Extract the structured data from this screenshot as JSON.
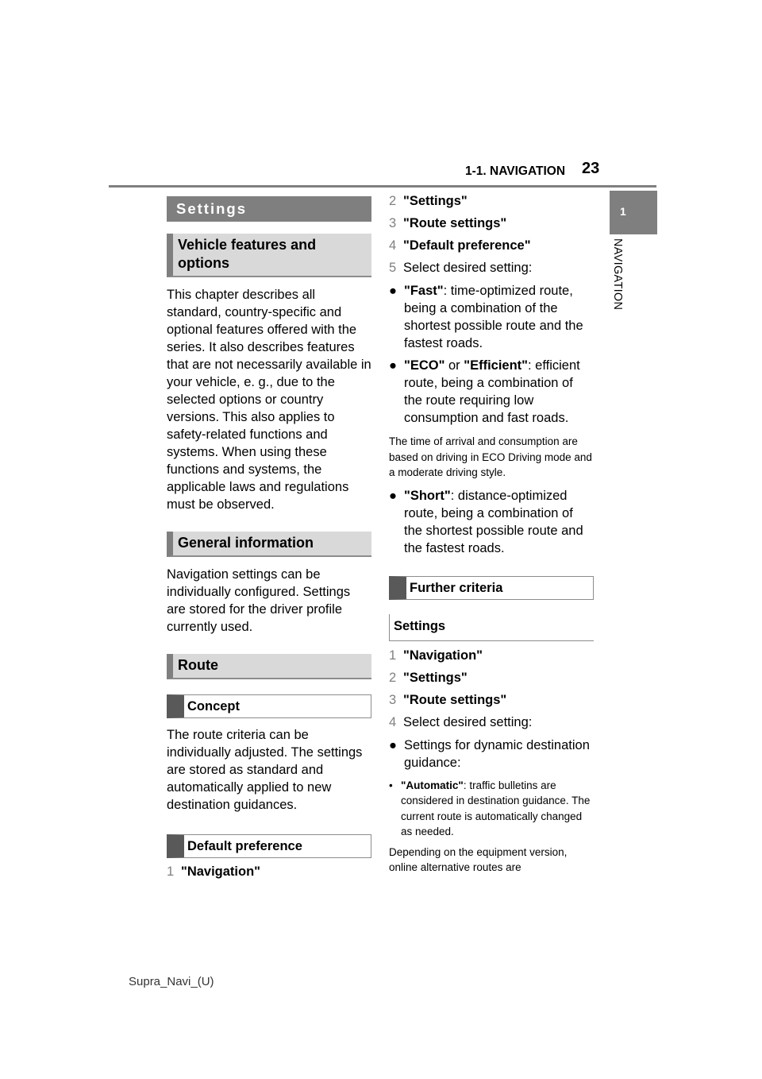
{
  "header": {
    "section": "1-1. NAVIGATION",
    "page_number": "23"
  },
  "side_tab": {
    "chapter_number": "1",
    "chapter_label": "NAVIGATION"
  },
  "footer": {
    "doc_id": "Supra_Navi_(U)"
  },
  "left_column": {
    "settings_heading": "Settings",
    "vehicle_features_heading": "Vehicle features and options",
    "vehicle_features_text": "This chapter describes all standard, country-specific and optional features offered with the series. It also describes features that are not necessarily available in your vehicle, e. g., due to the selected options or country versions. This also applies to safety-related functions and systems. When using these functions and systems, the applicable laws and regulations must be observed.",
    "general_info_heading": "General information",
    "general_info_text": "Navigation settings can be individually configured. Settings are stored for the driver profile currently used.",
    "route_heading": "Route",
    "concept_heading": "Concept",
    "concept_text": "The route criteria can be individually adjusted. The settings are stored as standard and automatically applied to new destination guidances.",
    "default_pref_heading": "Default preference",
    "steps": [
      {
        "num": "1",
        "label": "\"Navigation\""
      }
    ]
  },
  "right_column": {
    "steps": [
      {
        "num": "2",
        "label": "\"Settings\""
      },
      {
        "num": "3",
        "label": "\"Route settings\""
      },
      {
        "num": "4",
        "label": "\"Default preference\""
      },
      {
        "num": "5",
        "label": "Select desired setting:"
      }
    ],
    "options": [
      {
        "name": "\"Fast\"",
        "text": ": time-optimized route, being a combination of the shortest possible route and the fastest roads."
      },
      {
        "name": "\"ECO\"",
        "mid": " or ",
        "name2": "\"Efficient\"",
        "text": ": efficient route, being a combination of the route requiring low consumption and fast roads."
      }
    ],
    "note": "The time of arrival and consumption are based on driving in ECO Driving mode and a moderate driving style.",
    "option_short": {
      "name": "\"Short\"",
      "text": ": distance-optimized route, being a combination of the shortest possible route and the fastest roads."
    },
    "further_heading": "Further criteria",
    "settings_subheading": "Settings",
    "steps2": [
      {
        "num": "1",
        "label": "\"Navigation\""
      },
      {
        "num": "2",
        "label": "\"Settings\""
      },
      {
        "num": "3",
        "label": "\"Route settings\""
      },
      {
        "num": "4",
        "label": "Select desired setting:"
      }
    ],
    "dynamic_bullet": "Settings for dynamic destination guidance:",
    "automatic": {
      "name": "\"Automatic\"",
      "text": ": traffic bulletins are considered in destination guidance. The current route is automatically changed as needed."
    },
    "tail_text": "Depending on the equipment version, online alternative routes are"
  }
}
